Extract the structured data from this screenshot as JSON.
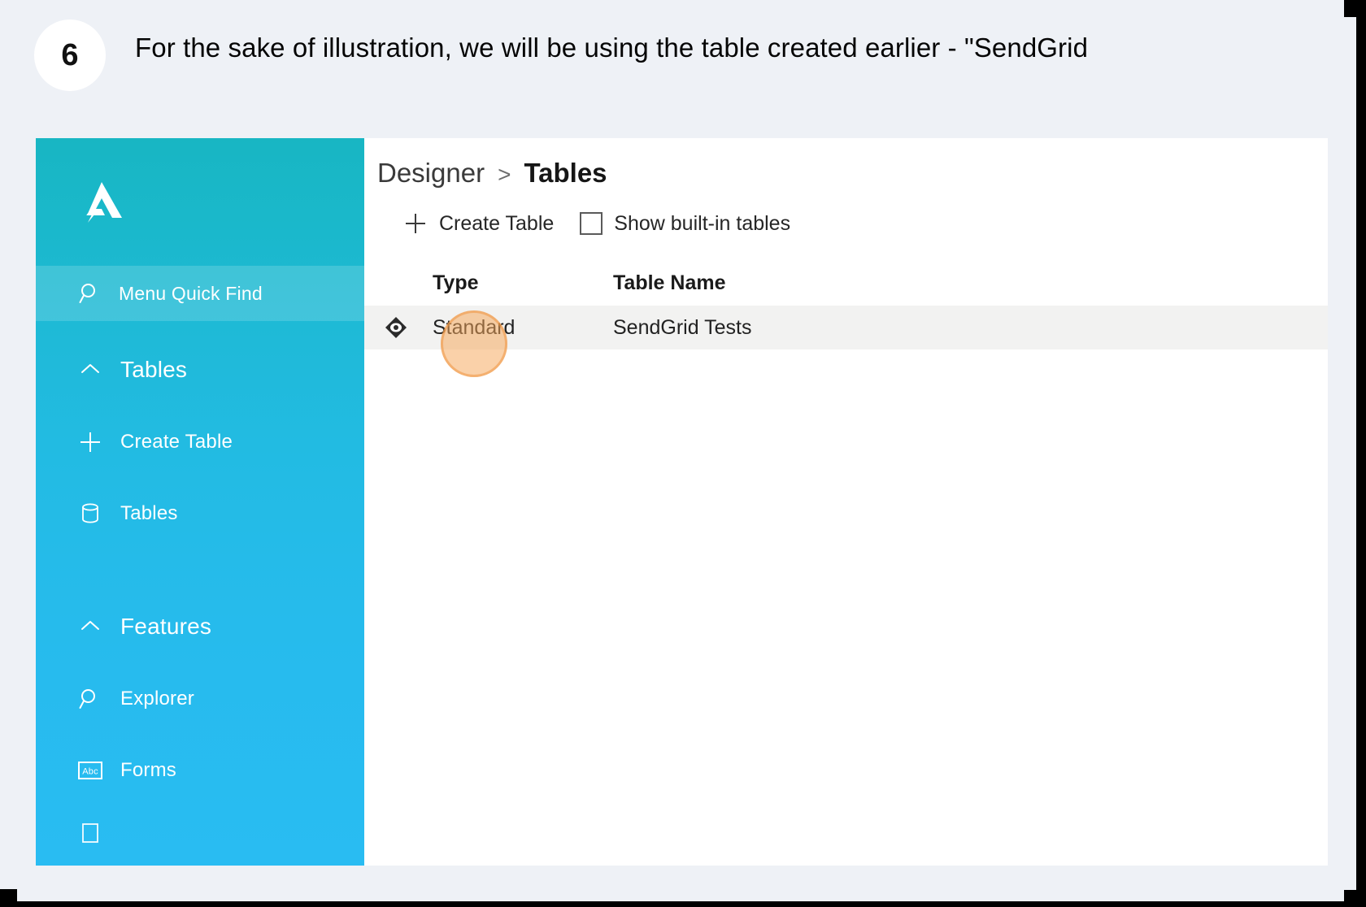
{
  "step": {
    "number": "6",
    "caption": "For the sake of illustration, we will be using the table created earlier - \"SendGrid"
  },
  "app": {
    "sidebar": {
      "logo_name": "appsheet-logo-icon",
      "quick_find": {
        "icon": "search-icon",
        "label": "Menu Quick Find"
      },
      "groups": [
        {
          "label": "Tables",
          "icon": "chevron-up-icon",
          "items": [
            {
              "label": "Create Table",
              "icon": "plus-icon"
            },
            {
              "label": "Tables",
              "icon": "database-icon"
            }
          ]
        },
        {
          "label": "Features",
          "icon": "chevron-up-icon",
          "items": [
            {
              "label": "Explorer",
              "icon": "search-icon"
            },
            {
              "label": "Forms",
              "icon": "abc-box-icon"
            }
          ]
        }
      ]
    },
    "main": {
      "breadcrumb": {
        "root": "Designer",
        "separator": ">",
        "current": "Tables"
      },
      "toolbar": {
        "create_table_label": "Create Table",
        "create_table_icon": "plus-icon",
        "show_builtin_label": "Show built-in tables",
        "show_builtin_checked": false
      },
      "table": {
        "columns": [
          "Type",
          "Table Name"
        ],
        "rows": [
          {
            "icon": "standard-table-icon",
            "type": "Standard",
            "name": "SendGrid Tests"
          }
        ]
      }
    }
  },
  "colors": {
    "page_background": "#eef1f6",
    "sidebar_top": "#18b6c3",
    "sidebar_bottom": "#29bcf2",
    "row_background": "#f2f2f1",
    "cursor_highlight": "#f5a65a"
  }
}
